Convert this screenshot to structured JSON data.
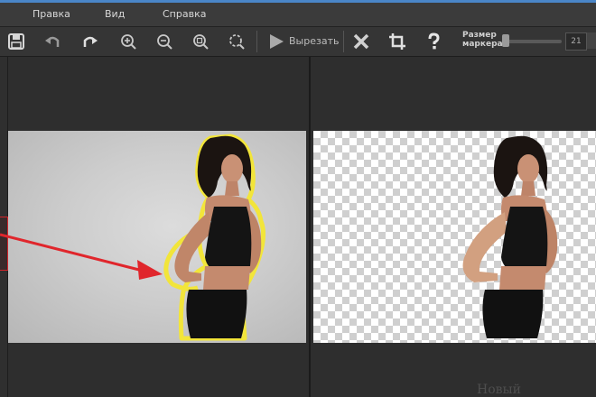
{
  "menu": {
    "items": [
      "Правка",
      "Вид",
      "Справка"
    ]
  },
  "toolbar": {
    "cut_label": "Вырезать",
    "marker_label_line1": "Размер",
    "marker_label_line2": "маркера",
    "marker_size": "21",
    "icons": [
      "save-icon",
      "undo-icon",
      "redo-icon",
      "zoom-in-icon",
      "zoom-out-icon",
      "zoom-actual-icon",
      "zoom-fit-icon",
      "play-icon",
      "close-icon",
      "crop-icon",
      "help-icon"
    ]
  },
  "colors": {
    "accent_red": "#e0262c",
    "outline_yellow": "#f2e53a",
    "topstrip": "#4a86c8"
  },
  "watermark": "Новый"
}
